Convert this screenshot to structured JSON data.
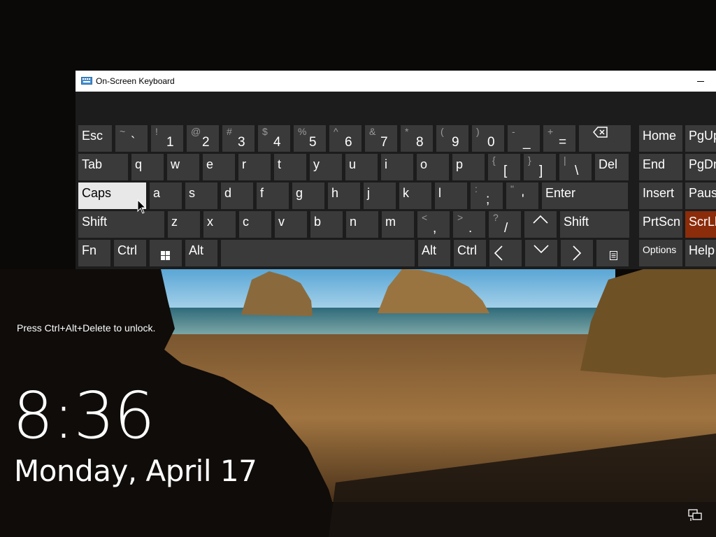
{
  "lock_screen": {
    "unlock_hint": "Press Ctrl+Alt+Delete to unlock.",
    "time": "8:36",
    "date": "Monday, April 17",
    "network_icon": "network-icon"
  },
  "osk": {
    "title": "On-Screen Keyboard",
    "title_icon": "keyboard-icon",
    "minimize_icon": "minimize-icon",
    "rows": {
      "row1": [
        {
          "id": "esc",
          "label": "Esc"
        },
        {
          "id": "tilde",
          "shift": "~",
          "main": "`"
        },
        {
          "id": "1",
          "shift": "!",
          "main": "1"
        },
        {
          "id": "2",
          "shift": "@",
          "main": "2"
        },
        {
          "id": "3",
          "shift": "#",
          "main": "3"
        },
        {
          "id": "4",
          "shift": "$",
          "main": "4"
        },
        {
          "id": "5",
          "shift": "%",
          "main": "5"
        },
        {
          "id": "6",
          "shift": "^",
          "main": "6"
        },
        {
          "id": "7",
          "shift": "&",
          "main": "7"
        },
        {
          "id": "8",
          "shift": "*",
          "main": "8"
        },
        {
          "id": "9",
          "shift": "(",
          "main": "9"
        },
        {
          "id": "0",
          "shift": ")",
          "main": "0"
        },
        {
          "id": "minus",
          "shift": "-",
          "main": "_"
        },
        {
          "id": "equals",
          "shift": "+",
          "main": "="
        },
        {
          "id": "backspace",
          "icon": "backspace-icon"
        }
      ],
      "row2": [
        {
          "id": "tab",
          "label": "Tab"
        },
        {
          "id": "q",
          "label": "q"
        },
        {
          "id": "w",
          "label": "w"
        },
        {
          "id": "e",
          "label": "e"
        },
        {
          "id": "r",
          "label": "r"
        },
        {
          "id": "t",
          "label": "t"
        },
        {
          "id": "y",
          "label": "y"
        },
        {
          "id": "u",
          "label": "u"
        },
        {
          "id": "i",
          "label": "i"
        },
        {
          "id": "o",
          "label": "o"
        },
        {
          "id": "p",
          "label": "p"
        },
        {
          "id": "lbracket",
          "shift": "{",
          "main": "["
        },
        {
          "id": "rbracket",
          "shift": "}",
          "main": "]"
        },
        {
          "id": "backslash",
          "shift": "|",
          "main": "\\"
        },
        {
          "id": "del",
          "label": "Del"
        }
      ],
      "row3": [
        {
          "id": "caps",
          "label": "Caps"
        },
        {
          "id": "a",
          "label": "a"
        },
        {
          "id": "s",
          "label": "s"
        },
        {
          "id": "d",
          "label": "d"
        },
        {
          "id": "f",
          "label": "f"
        },
        {
          "id": "g",
          "label": "g"
        },
        {
          "id": "h",
          "label": "h"
        },
        {
          "id": "j",
          "label": "j"
        },
        {
          "id": "k",
          "label": "k"
        },
        {
          "id": "l",
          "label": "l"
        },
        {
          "id": "semicolon",
          "shift": ":",
          "main": ";"
        },
        {
          "id": "quote",
          "shift": "\"",
          "main": "'"
        },
        {
          "id": "enter",
          "label": "Enter"
        }
      ],
      "row4": [
        {
          "id": "lshift",
          "label": "Shift"
        },
        {
          "id": "z",
          "label": "z"
        },
        {
          "id": "x",
          "label": "x"
        },
        {
          "id": "c",
          "label": "c"
        },
        {
          "id": "v",
          "label": "v"
        },
        {
          "id": "b",
          "label": "b"
        },
        {
          "id": "n",
          "label": "n"
        },
        {
          "id": "m",
          "label": "m"
        },
        {
          "id": "comma",
          "shift": "<",
          "main": ","
        },
        {
          "id": "period",
          "shift": ">",
          "main": "."
        },
        {
          "id": "slash",
          "shift": "?",
          "main": "/"
        },
        {
          "id": "up",
          "icon": "arrow-up-icon"
        },
        {
          "id": "rshift",
          "label": "Shift"
        }
      ],
      "row5": [
        {
          "id": "fn",
          "label": "Fn"
        },
        {
          "id": "lctrl",
          "label": "Ctrl"
        },
        {
          "id": "win",
          "icon": "windows-icon"
        },
        {
          "id": "lalt",
          "label": "Alt"
        },
        {
          "id": "space",
          "label": ""
        },
        {
          "id": "ralt",
          "label": "Alt"
        },
        {
          "id": "rctrl",
          "label": "Ctrl"
        },
        {
          "id": "left",
          "icon": "arrow-left-icon"
        },
        {
          "id": "down",
          "icon": "arrow-down-icon"
        },
        {
          "id": "right",
          "icon": "arrow-right-icon"
        },
        {
          "id": "menu",
          "icon": "context-menu-icon"
        }
      ]
    },
    "side_keys": [
      {
        "id": "home",
        "label": "Home"
      },
      {
        "id": "pgup",
        "label": "PgUp"
      },
      {
        "id": "end",
        "label": "End"
      },
      {
        "id": "pgdn",
        "label": "PgDn"
      },
      {
        "id": "insert",
        "label": "Insert"
      },
      {
        "id": "pause",
        "label": "Pause"
      },
      {
        "id": "prtscn",
        "label": "PrtScn"
      },
      {
        "id": "scrlk",
        "label": "ScrLk"
      },
      {
        "id": "options",
        "label": "Options"
      },
      {
        "id": "help",
        "label": "Help"
      }
    ],
    "colors": {
      "key": "#3a3a3a",
      "caps_active": "#e8e8e8",
      "scrlk_active": "#8b2c0a",
      "panel": "#1c1c1c"
    }
  }
}
